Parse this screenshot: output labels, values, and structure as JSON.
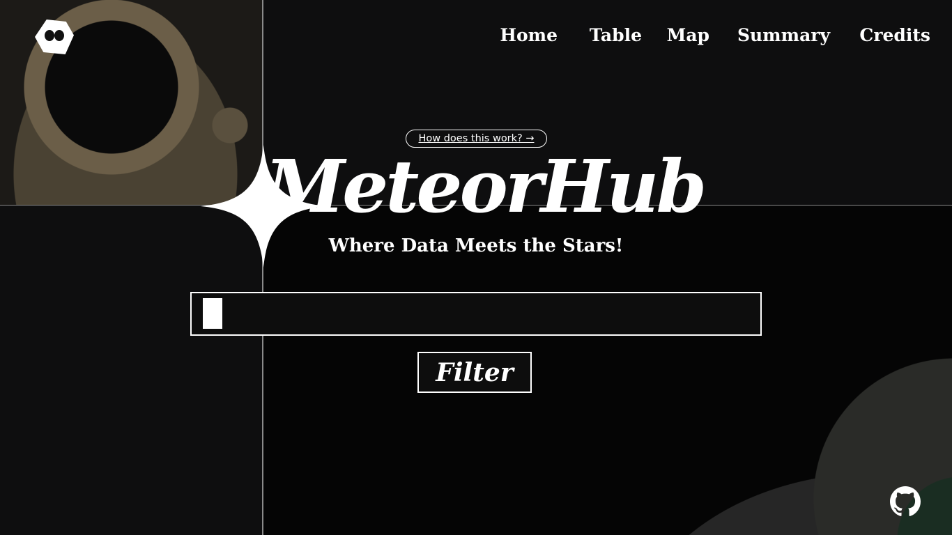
{
  "header": {
    "logo_icon": "octo-mask-logo-icon",
    "nav": [
      {
        "label": "Home"
      },
      {
        "label": "Table"
      },
      {
        "label": "Map"
      },
      {
        "label": "Summary"
      },
      {
        "label": "Credits"
      }
    ]
  },
  "hero": {
    "how_link": "How does this work? →",
    "title": "MeteorHub",
    "subtitle": "Where Data Meets the Stars!",
    "sparkle_icon": "four-point-star-icon"
  },
  "search": {
    "value": "",
    "placeholder": ""
  },
  "filter_button": {
    "label": "Filter"
  },
  "footer": {
    "github_icon": "github-icon"
  },
  "colors": {
    "background": "#0e0e0f",
    "foreground": "#ffffff",
    "divider": "#8a8a8a"
  }
}
